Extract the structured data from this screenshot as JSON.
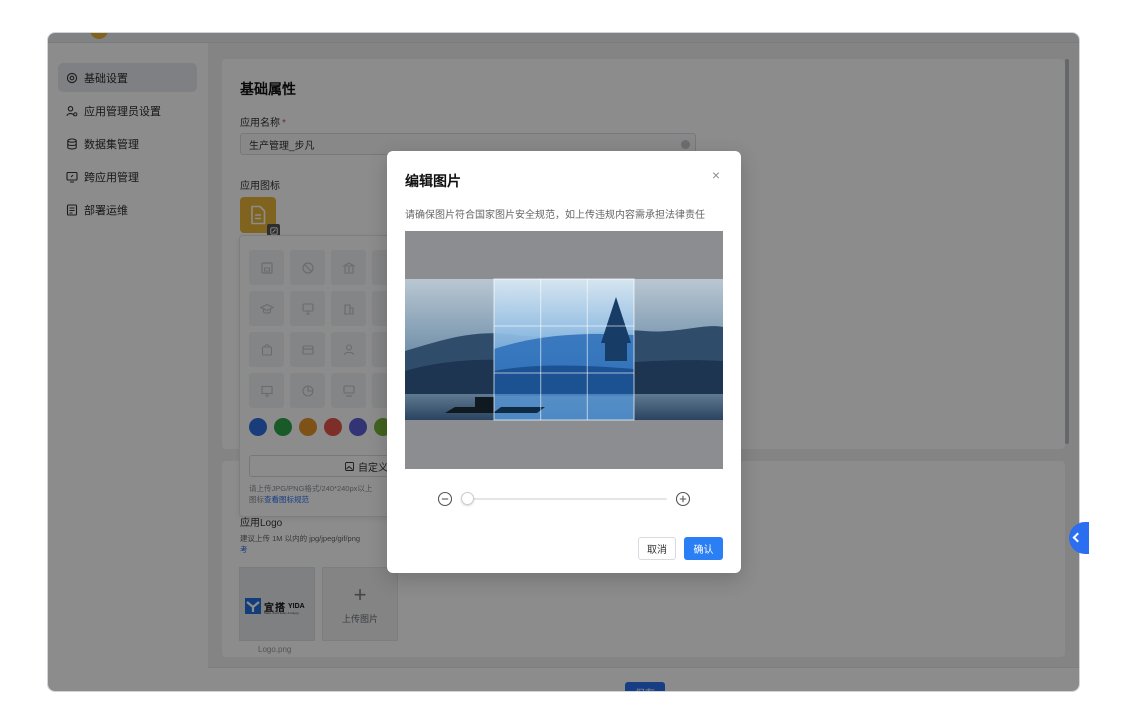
{
  "sidebar": {
    "items": [
      {
        "label": "基础设置",
        "icon": "settings-icon",
        "active": true
      },
      {
        "label": "应用管理员设置",
        "icon": "user-group-icon",
        "active": false
      },
      {
        "label": "数据集管理",
        "icon": "database-icon",
        "active": false
      },
      {
        "label": "跨应用管理",
        "icon": "cross-app-icon",
        "active": false
      },
      {
        "label": "部署运维",
        "icon": "deploy-icon",
        "active": false
      }
    ]
  },
  "basic": {
    "section_title": "基础属性",
    "name_label": "应用名称",
    "required_mark": "*",
    "name_value": "生产管理_步凡",
    "icon_label": "应用图标"
  },
  "icon_picker": {
    "custom_button": "自定义图",
    "hint_line1": "请上传JPG/PNG格式/240*240px以上",
    "hint_prefix": "图标",
    "hint_link": "查看图标规范",
    "swatch_colors": [
      "#2f6fe0",
      "#2ea64a",
      "#e6942a",
      "#e5544a",
      "#5b5fd6",
      "#79b43a"
    ]
  },
  "logo": {
    "label": "应用Logo",
    "hint": "建议上传 1M 以内的 jpg/jpeg/gif/png",
    "hint_link": "考",
    "brand_text": "宜搭",
    "brand_en": "YIDA",
    "brand_tagline": "Make Work Easy & Happy",
    "filename": "Logo.png",
    "upload_label": "上传图片"
  },
  "footer": {
    "save_label": "保存"
  },
  "modal": {
    "title": "编辑图片",
    "close": "×",
    "description": "请确保图片符合国家图片安全规范，如上传违规内容需承担法律责任",
    "zoom_level": 0.03,
    "cancel_label": "取消",
    "ok_label": "确认"
  },
  "colors": {
    "primary": "#2b7ff5",
    "app_icon_bg": "#e9b538",
    "required": "#e5484d"
  }
}
